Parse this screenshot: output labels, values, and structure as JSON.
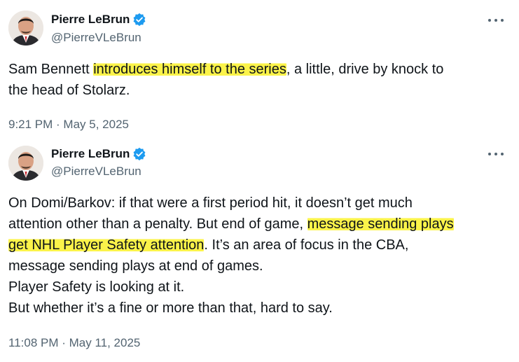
{
  "tweets": [
    {
      "author": {
        "name": "Pierre LeBrun",
        "handle": "@PierreVLeBrun",
        "avatar_icon": "profile-photo",
        "verified_icon": "verified-badge-icon"
      },
      "body": {
        "lines": [
          {
            "pre": "Sam Bennett ",
            "hl": "introduces himself to the series",
            "post": ", a little, drive by knock to"
          },
          {
            "pre": "the head of Stolarz.",
            "hl": "",
            "post": ""
          }
        ]
      },
      "timestamp": "9:21 PM · May 5, 2025"
    },
    {
      "author": {
        "name": "Pierre LeBrun",
        "handle": "@PierreVLeBrun",
        "avatar_icon": "profile-photo",
        "verified_icon": "verified-badge-icon"
      },
      "body": {
        "lines": [
          {
            "pre": "On Domi/Barkov: if that were a first period hit, it doesn’t get much",
            "hl": "",
            "post": ""
          },
          {
            "pre": "attention other than a penalty. But end of game, ",
            "hl": "message sending plays",
            "post": ""
          },
          {
            "pre": "",
            "hl": "get NHL Player Safety attention",
            "post": ". It’s an area of focus in the CBA,"
          },
          {
            "pre": "message sending plays at end of games.",
            "hl": "",
            "post": ""
          },
          {
            "pre": "Player Safety is looking at it.",
            "hl": "",
            "post": ""
          },
          {
            "pre": "But whether it’s a fine or more than that, hard to say.",
            "hl": "",
            "post": ""
          }
        ]
      },
      "timestamp": "11:08 PM · May 11, 2025"
    }
  ],
  "colors": {
    "text": "#0f1419",
    "secondary": "#536471",
    "verified": "#1d9bf0",
    "highlight": "#fbf34a"
  }
}
